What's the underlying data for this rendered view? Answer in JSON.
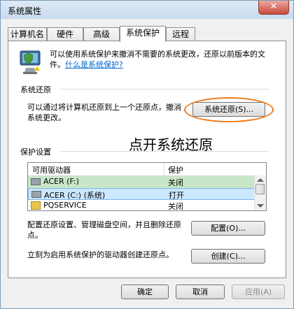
{
  "window": {
    "title": "系统属性",
    "close_glyph": "✕"
  },
  "tabs": [
    {
      "label": "计算机名",
      "active": false
    },
    {
      "label": "硬件",
      "active": false
    },
    {
      "label": "高级",
      "active": false
    },
    {
      "label": "系统保护",
      "active": true
    },
    {
      "label": "远程",
      "active": false
    }
  ],
  "intro": {
    "text": "可以使用系统保护来撤消不需要的系统更改，还原以前版本的文件。",
    "link": "什么是系统保护?",
    "icon": "shield-computer-icon"
  },
  "restore": {
    "group_label": "系统还原",
    "desc": "可以通过将计算机还原到上一个还原点，撤消系统更改。",
    "button": "系统还原(S)..."
  },
  "annotation": "点开系统还原",
  "protection": {
    "group_label": "保护设置",
    "headers": [
      "可用驱动器",
      "保护"
    ],
    "rows": [
      {
        "drive": "ACER (F:)",
        "status": "关闭",
        "icon": "drive-icon",
        "selected": false
      },
      {
        "drive": "ACER (C:) (系统)",
        "status": "打开",
        "icon": "drive-icon",
        "selected": true
      },
      {
        "drive": "PQSERVICE",
        "status": "关闭",
        "icon": "folder-icon",
        "selected": false
      }
    ],
    "config_desc": "配置还原设置、管理磁盘空间，并且删除还原点。",
    "config_button": "配置(O)...",
    "create_desc": "立刻为启用系统保护的驱动器创建还原点。",
    "create_button": "创建(C)..."
  },
  "footer": {
    "ok": "确定",
    "cancel": "取消",
    "apply": "应用(A)"
  },
  "colors": {
    "selected_row": "#cce8ff",
    "highlight_ring": "#ee7a1a",
    "row_green": "#c8e6c8"
  }
}
